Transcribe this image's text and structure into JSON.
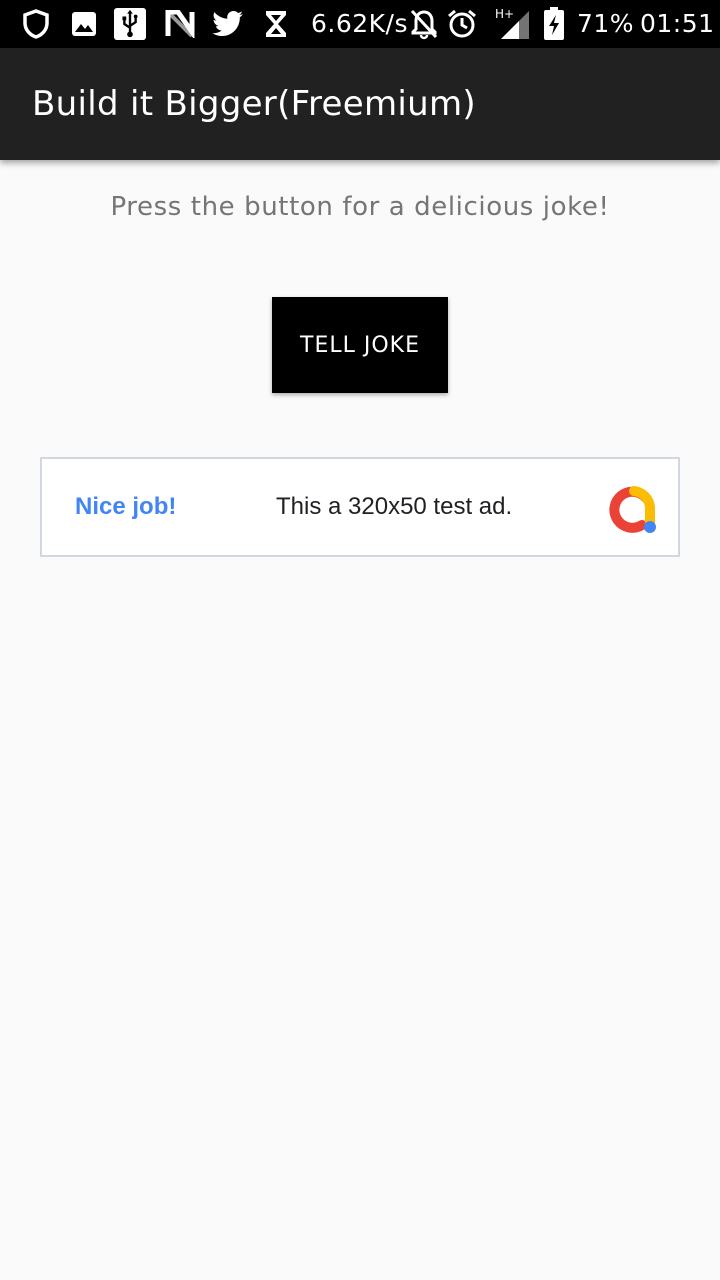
{
  "status_bar": {
    "speed": "6.62K/s",
    "network": "H+",
    "battery": "71%",
    "time": "01:51",
    "icons": [
      "shield-icon",
      "image-icon",
      "usb-icon",
      "n-icon",
      "twitter-icon",
      "hourglass-icon",
      "notifications-off-icon",
      "alarm-icon",
      "signal-icon",
      "battery-charging-icon"
    ]
  },
  "app_bar": {
    "title": "Build it Bigger(Freemium)"
  },
  "main": {
    "prompt": "Press the button for a delicious joke!",
    "button_label": "TELL JOKE"
  },
  "ad": {
    "headline": "Nice job!",
    "body": "This a 320x50 test ad.",
    "colors": {
      "headline": "#4285f4",
      "logo_red": "#ea4335",
      "logo_yellow": "#fbbc04",
      "logo_blue": "#4285f4"
    }
  }
}
